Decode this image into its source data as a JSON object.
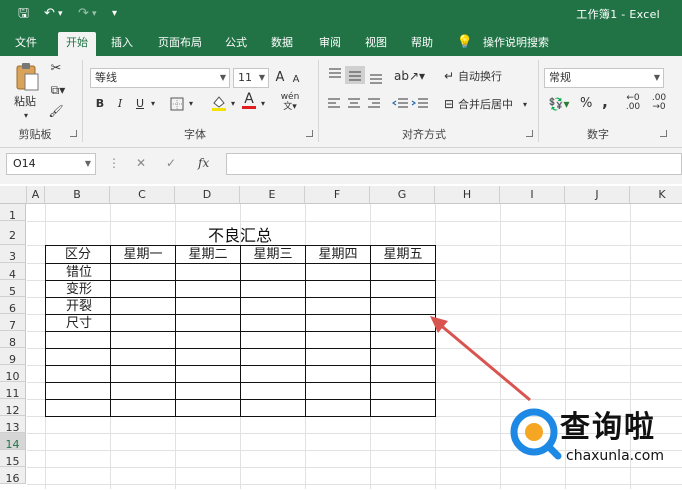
{
  "window": {
    "title": "工作簿1 - Excel"
  },
  "quick_access": {
    "save": "🖫",
    "undo": "↶",
    "redo": "↷",
    "customize": "▾"
  },
  "tabs": [
    {
      "label": "文件"
    },
    {
      "label": "开始"
    },
    {
      "label": "插入"
    },
    {
      "label": "页面布局"
    },
    {
      "label": "公式"
    },
    {
      "label": "数据"
    },
    {
      "label": "审阅"
    },
    {
      "label": "视图"
    },
    {
      "label": "帮助"
    },
    {
      "label": "操作说明搜索"
    }
  ],
  "ribbon": {
    "clipboard": {
      "paste": "粘贴",
      "label": "剪贴板"
    },
    "font": {
      "name": "等线",
      "size": "11",
      "bold": "B",
      "italic": "I",
      "underline": "U",
      "wen": "wén",
      "label": "字体",
      "grow": "A",
      "shrink": "A",
      "font_color": "A"
    },
    "alignment": {
      "wrap": "自动换行",
      "merge": "合并后居中",
      "label": "对齐方式"
    },
    "number": {
      "format": "常规",
      "percent": "%",
      "comma": ",",
      "label": "数字"
    }
  },
  "formula_bar": {
    "name_box": "O14",
    "fx": "fx",
    "value": ""
  },
  "columns": [
    "A",
    "B",
    "C",
    "D",
    "E",
    "F",
    "G",
    "H",
    "I",
    "J",
    "K"
  ],
  "rows": [
    "1",
    "2",
    "3",
    "4",
    "5",
    "6",
    "7",
    "8",
    "9",
    "10",
    "11",
    "12",
    "13",
    "14",
    "15",
    "16"
  ],
  "sheet": {
    "title": "不良汇总",
    "headers": [
      "区分",
      "星期一",
      "星期二",
      "星期三",
      "星期四",
      "星期五"
    ],
    "row_labels": [
      "错位",
      "变形",
      "开裂",
      "尺寸",
      "",
      "",
      "",
      "",
      ""
    ]
  },
  "watermark": {
    "text": "查询啦",
    "url": "chaxunla.com"
  },
  "colors": {
    "accent": "#217346",
    "arrow": "#d9534f",
    "logo_blue": "#1e88e5",
    "logo_orange": "#f5a623"
  }
}
